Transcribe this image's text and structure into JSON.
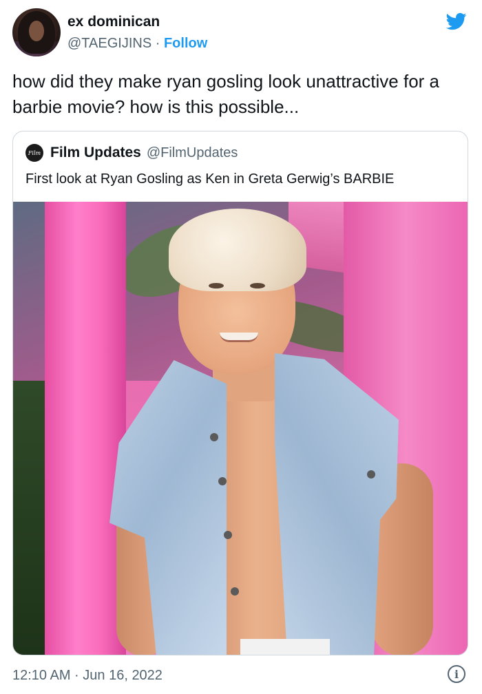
{
  "author": {
    "name": "ex dominican",
    "handle": "@TAEGIJINS",
    "separator": "·",
    "follow_label": "Follow"
  },
  "tweet": {
    "text": "how did they make ryan gosling look unattractive for a barbie movie? how is this possible..."
  },
  "quoted": {
    "name": "Film Updates",
    "handle": "@FilmUpdates",
    "text": "First look at Ryan Gosling as Ken in Greta Gerwig’s BARBIE",
    "avatar_text": "Film"
  },
  "footer": {
    "timestamp": "12:10 AM · Jun 16, 2022",
    "info_symbol": "i"
  },
  "icons": {
    "brand": "twitter-bird-icon",
    "info": "info-icon"
  },
  "colors": {
    "link": "#1d9bf0",
    "secondary_text": "#536471",
    "border": "#cfd9de"
  }
}
